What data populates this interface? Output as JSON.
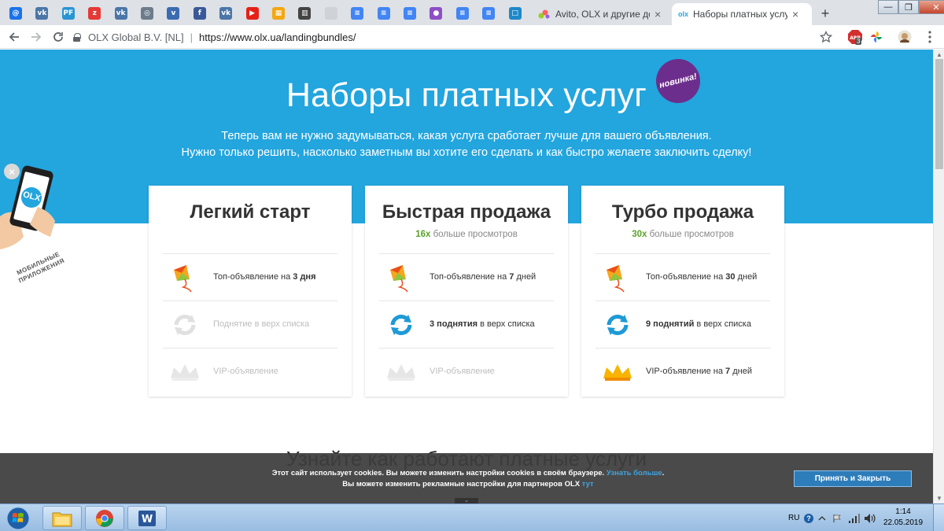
{
  "browser": {
    "pinned_tabs": [
      {
        "icon": "at-icon",
        "glyph": "@",
        "color": "#1a73e8"
      },
      {
        "icon": "vk-icon",
        "glyph": "vk",
        "color": "#4a76a8"
      },
      {
        "icon": "pf-icon",
        "glyph": "PF",
        "color": "#2a95d3"
      },
      {
        "icon": "z-icon",
        "glyph": "z",
        "color": "#e53935"
      },
      {
        "icon": "vk-icon",
        "glyph": "vk",
        "color": "#4a76a8"
      },
      {
        "icon": "globe-icon",
        "glyph": "◎",
        "color": "#6d7b8a"
      },
      {
        "icon": "v-icon",
        "glyph": "v",
        "color": "#3b6bb0"
      },
      {
        "icon": "facebook-icon",
        "glyph": "f",
        "color": "#3b5998"
      },
      {
        "icon": "vk-icon",
        "glyph": "vk",
        "color": "#4a76a8"
      },
      {
        "icon": "youtube-icon",
        "glyph": "▶",
        "color": "#e62117"
      },
      {
        "icon": "grid-icon",
        "glyph": "▦",
        "color": "#f3a712"
      },
      {
        "icon": "trello-icon",
        "glyph": "▥",
        "color": "#444"
      },
      {
        "icon": "blank-icon",
        "glyph": "",
        "color": "#cfd3d8"
      },
      {
        "icon": "docs-icon",
        "glyph": "≡",
        "color": "#4285f4"
      },
      {
        "icon": "docs-icon",
        "glyph": "≡",
        "color": "#4285f4"
      },
      {
        "icon": "docs-icon",
        "glyph": "≡",
        "color": "#4285f4"
      },
      {
        "icon": "monster-icon",
        "glyph": "●",
        "color": "#8e4ec6"
      },
      {
        "icon": "docs-icon",
        "glyph": "≡",
        "color": "#4285f4"
      },
      {
        "icon": "docs-icon",
        "glyph": "≡",
        "color": "#4285f4"
      },
      {
        "icon": "square-icon",
        "glyph": "□",
        "color": "#1e88c8"
      }
    ],
    "tabs": [
      {
        "title": "Avito, OLX и другие доски",
        "close": "×"
      },
      {
        "title": "Наборы платных услуг",
        "close": "×"
      }
    ],
    "new_tab": "+",
    "window_controls": {
      "minimize": "—",
      "restore": "❐",
      "close": "✕"
    },
    "site_info": "OLX Global B.V. [NL]",
    "url_sep": "|",
    "url": "https://www.olx.ua/landingbundles/",
    "extension_badge": "3"
  },
  "page": {
    "hero_title": "Наборы платных услуг",
    "new_badge": "новинка!",
    "subtitle_line1": "Теперь вам не нужно задумываться, какая услуга сработает лучше для вашего объявления.",
    "subtitle_line2": "Нужно только решить, насколько заметным вы хотите его сделать и как быстро желаете заключить сделку!",
    "mobile_close": "×",
    "mobile_caption_line1": "МОБИЛЬНЫЕ",
    "mobile_caption_line2": "ПРИЛОЖЕНИЯ",
    "mobile_logo": "OLX",
    "cards": [
      {
        "title": "Легкий старт",
        "views_num": "",
        "views_text": "",
        "f1_pre": "Топ-объявление на ",
        "f1_bold": "3 дня",
        "f1_post": "",
        "f2_pre": "",
        "f2_bold": "",
        "f2_post": "Поднятие в верх списка",
        "f3": "VIP-объявление"
      },
      {
        "title": "Быстрая продажа",
        "views_num": "16x",
        "views_text": " больше просмотров",
        "f1_pre": "Топ-объявление на ",
        "f1_bold": "7",
        "f1_post": " дней",
        "f2_pre": "",
        "f2_bold": "3 поднятия",
        "f2_post": " в верх списка",
        "f3": "VIP-объявление"
      },
      {
        "title": "Турбо продажа",
        "views_num": "30x",
        "views_text": " больше просмотров",
        "f1_pre": "Топ-объявление на ",
        "f1_bold": "30",
        "f1_post": " дней",
        "f2_pre": "",
        "f2_bold": "9 поднятий",
        "f2_post": " в верх списка",
        "f3_pre": "VIP-объявление на ",
        "f3_bold": "7",
        "f3_post": " дней"
      }
    ],
    "faded_heading": "Узнайте как работают платные услуги",
    "cookie": {
      "line1": "Этот сайт использует cookies. Вы можете изменить настройки cookies в своём браузере. ",
      "line1_link": "Узнать больше",
      "line1_end": ".",
      "line2": "Вы можете изменить рекламные настройки для партнеров OLX ",
      "line2_link": "тут",
      "accept": "Принять и Закрыть"
    }
  },
  "taskbar": {
    "lang": "RU",
    "help": "?",
    "time": "1:14",
    "date": "22.05.2019"
  },
  "colors": {
    "hero": "#23a5de",
    "accent_green": "#5aa12a",
    "badge_purple": "#6c2e8c",
    "button_blue": "#2e7dbb"
  }
}
